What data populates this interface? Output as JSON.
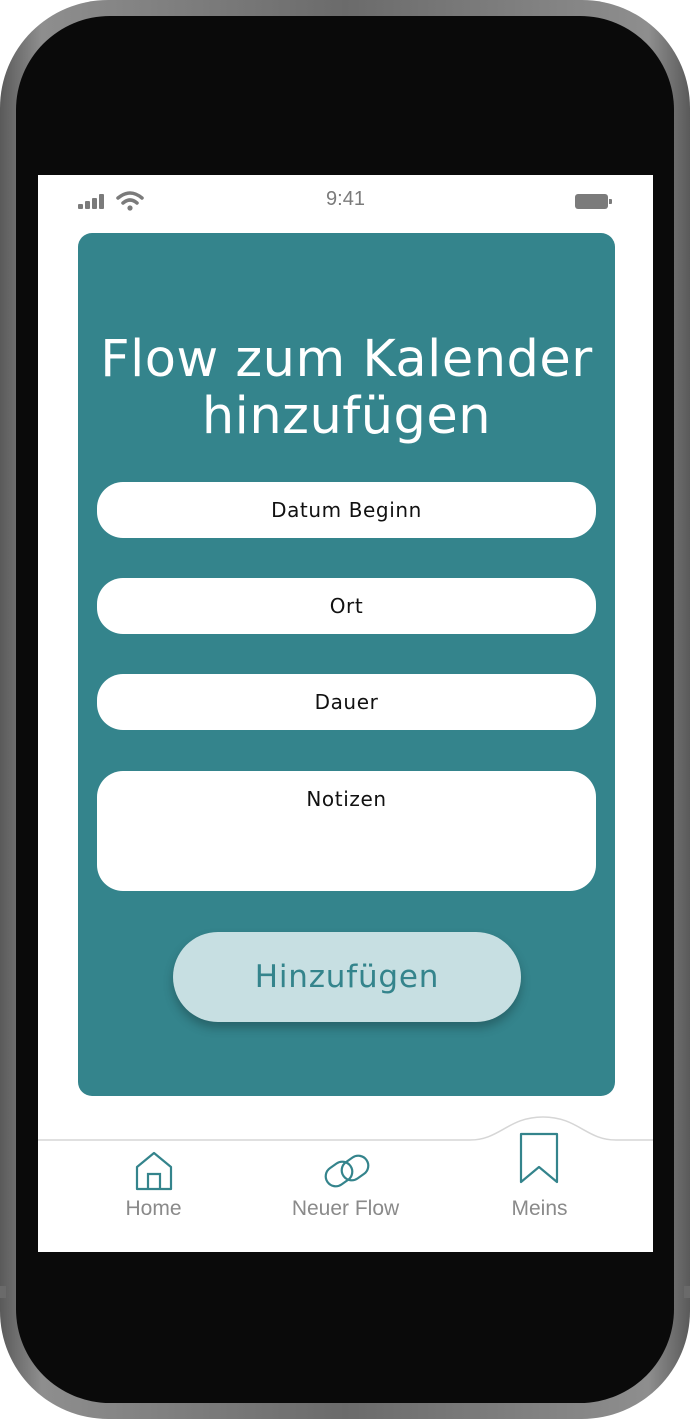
{
  "status_bar": {
    "time": "9:41"
  },
  "card": {
    "title_line1": "Flow zum Kalender",
    "title_line2": "hinzufügen"
  },
  "form": {
    "fields": [
      {
        "label": "Datum Beginn"
      },
      {
        "label": "Ort"
      },
      {
        "label": "Dauer"
      },
      {
        "label": "Notizen"
      }
    ],
    "submit_label": "Hinzufügen"
  },
  "tabbar": {
    "items": [
      {
        "label": "Home",
        "icon": "home-icon"
      },
      {
        "label": "Neuer Flow",
        "icon": "link-icon"
      },
      {
        "label": "Meins",
        "icon": "bookmark-icon",
        "active": true
      }
    ]
  },
  "colors": {
    "accent": "#34848c",
    "button_bg": "#c7dfe2",
    "tab_label": "#8a8a8a"
  }
}
